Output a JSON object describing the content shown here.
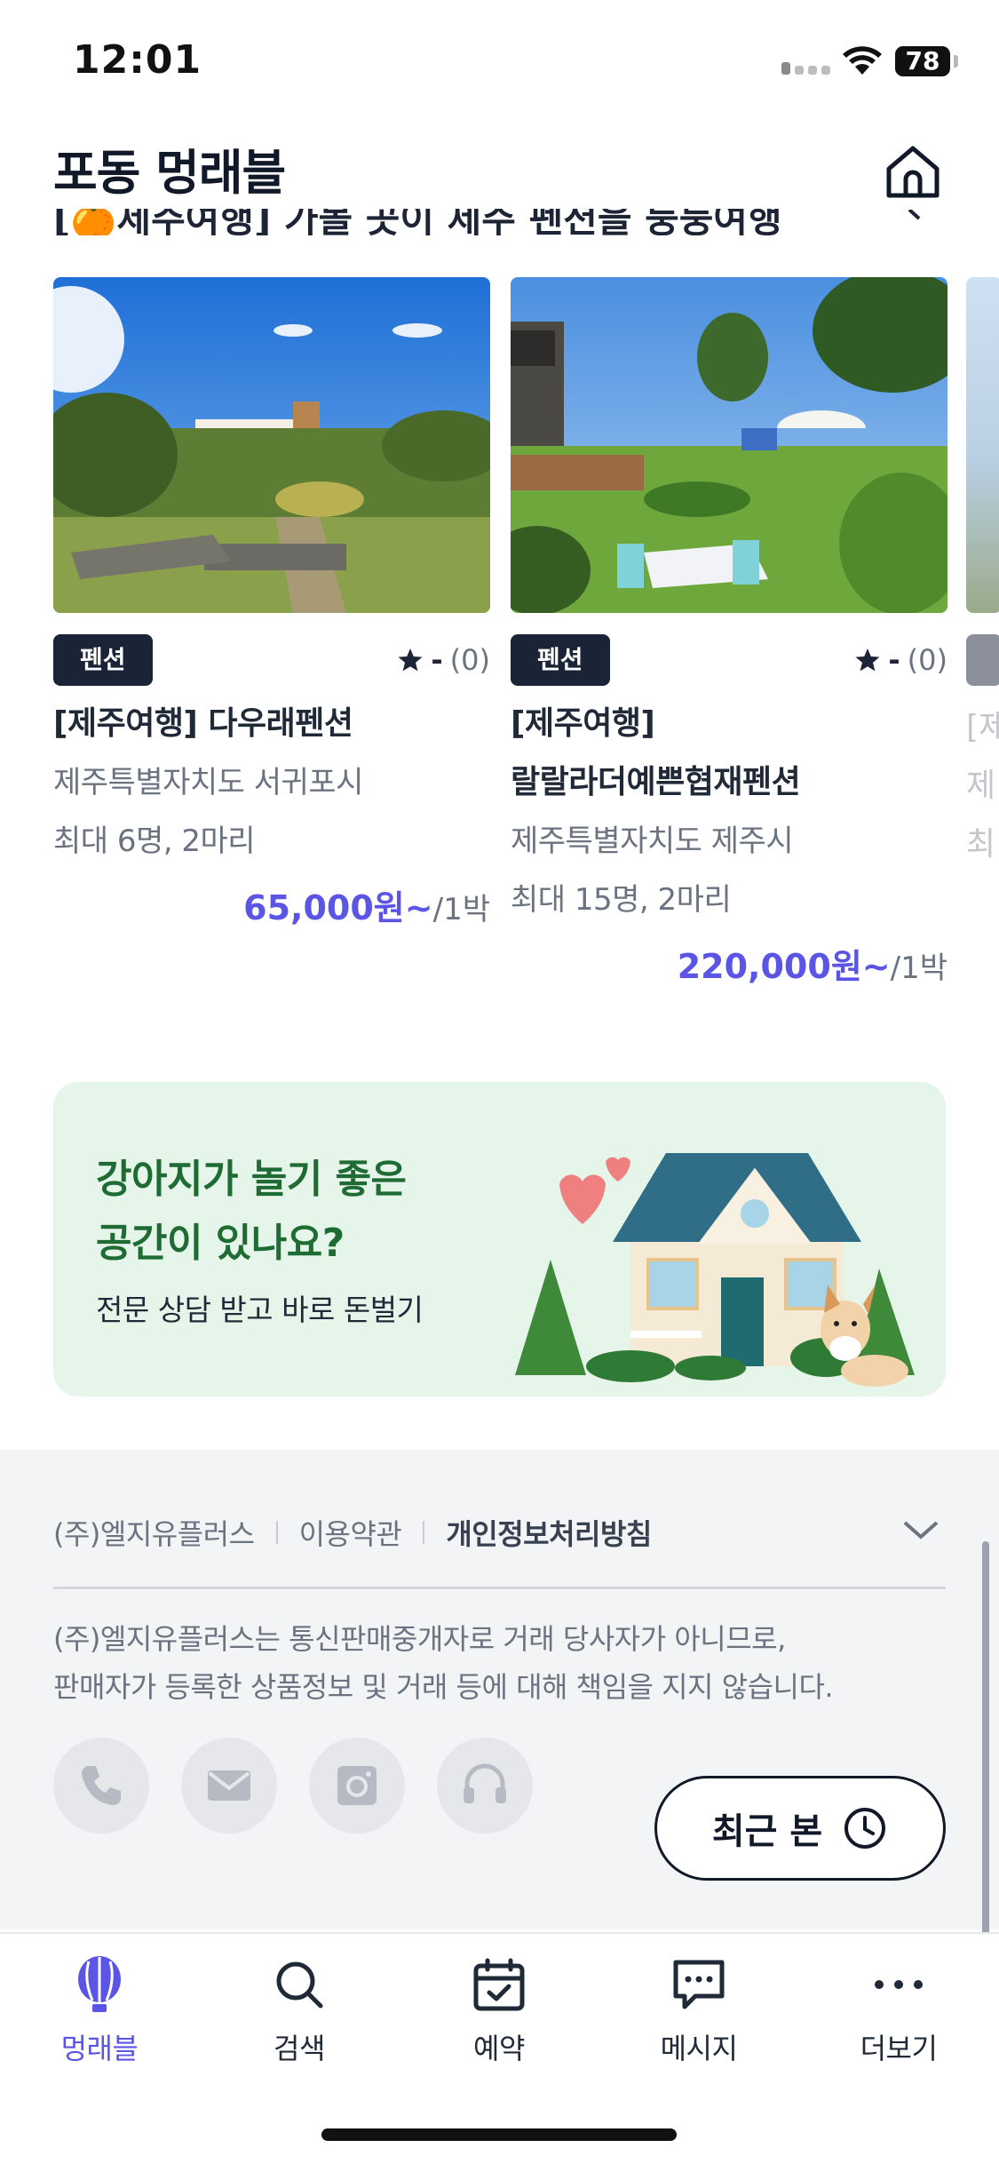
{
  "status_bar": {
    "time": "12:01",
    "battery": "78"
  },
  "header": {
    "title": "포동 멍래블"
  },
  "section_peek": {
    "title": "[🍊제주여행] 가볼 곳이 제주 펜션을 둥둥여행"
  },
  "cards": [
    {
      "badge": "펜션",
      "rating": "-",
      "review_count": "(0)",
      "name": "[제주여행] 다우래펜션",
      "address": "제주특별자치도 서귀포시",
      "capacity": "최대 6명, 2마리",
      "price": "65,000원~",
      "price_unit": "/1박"
    },
    {
      "badge": "펜션",
      "rating": "-",
      "review_count": "(0)",
      "name_line1": "[제주여행]",
      "name_line2": "랄랄라더예쁜협재펜션",
      "address": "제주특별자치도 제주시",
      "capacity": "최대 15명, 2마리",
      "price": "220,000원~",
      "price_unit": "/1박"
    }
  ],
  "card3_peek": {
    "name": "[제",
    "address": "제",
    "capacity": "최"
  },
  "promo": {
    "title_line1": "강아지가 놀기 좋은",
    "title_line2": "공간이 있나요?",
    "subtitle": "전문 상담 받고 바로 돈벌기"
  },
  "footer": {
    "company": "(주)엘지유플러스",
    "terms": "이용약관",
    "privacy": "개인정보처리방침",
    "notice_line1": "(주)엘지유플러스는 통신판매중개자로 거래 당사자가 아니므로,",
    "notice_line2": "판매자가 등록한 상품정보 및 거래 등에 대해 책임을 지지 않습니다.",
    "social_icons": [
      "phone-icon",
      "mail-icon",
      "instagram-icon",
      "headset-icon"
    ]
  },
  "recent_button": {
    "label": "최근 본"
  },
  "tabs": [
    {
      "label": "멍래블",
      "icon": "balloon-icon",
      "active": true
    },
    {
      "label": "검색",
      "icon": "search-icon",
      "active": false
    },
    {
      "label": "예약",
      "icon": "calendar-check-icon",
      "active": false
    },
    {
      "label": "메시지",
      "icon": "message-icon",
      "active": false
    },
    {
      "label": "더보기",
      "icon": "more-icon",
      "active": false
    }
  ],
  "colors": {
    "accent": "#5b55e6",
    "dark": "#1b2436",
    "promo_bg": "#e6f5ea",
    "promo_title": "#1f6b34",
    "footer_bg": "#f3f4f6"
  }
}
